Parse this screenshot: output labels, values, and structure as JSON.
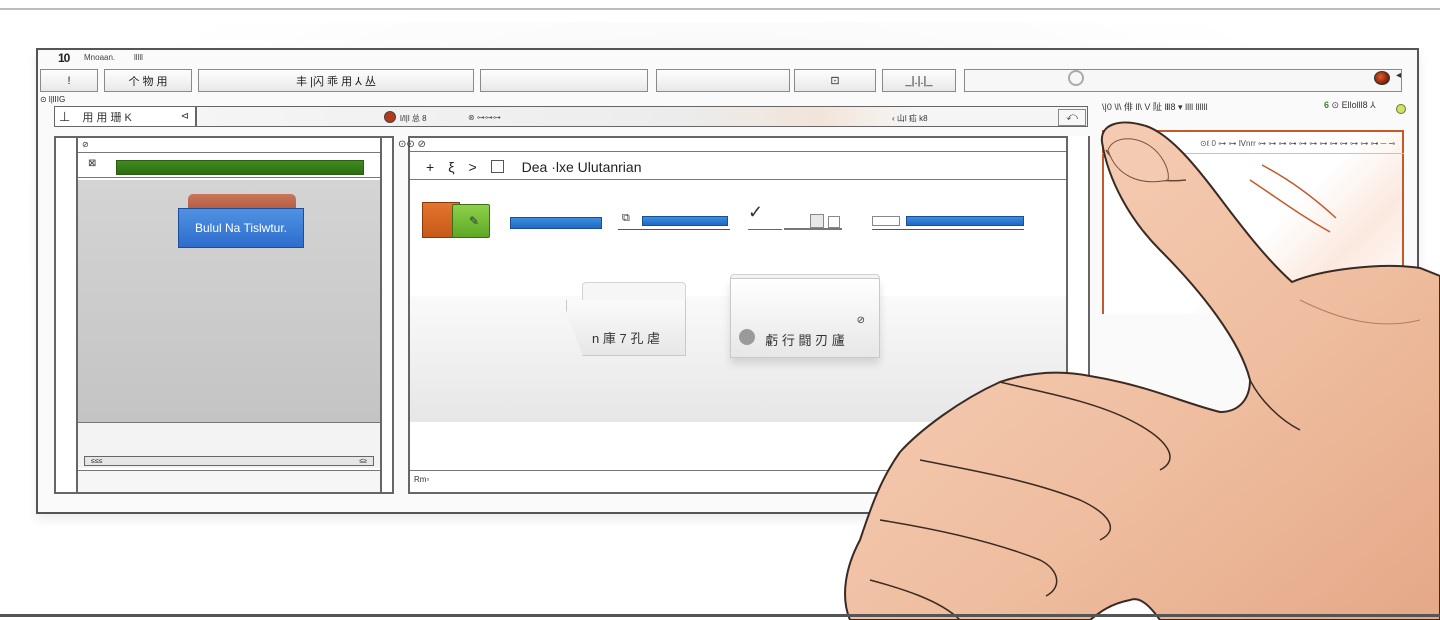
{
  "window": {
    "logo": "10",
    "title": "Mnoaan.",
    "subtitle": "lllll"
  },
  "toolbar": {
    "nav_label": "!",
    "open_label": "个 物 用",
    "tools_label": "丰   |闪 乖 用 ⅄   丛",
    "btn_a_label": "",
    "btn_b_label": "",
    "view_label": "⊡",
    "zoom_label": "_|.|.|_",
    "search_placeholder": ""
  },
  "address": {
    "status": "⊙ l|lIIG",
    "combo_label": "用  用 珊 K",
    "tab1_label": "l/l|l 总 8",
    "tab2_label": "⊗ ⊶⊶⊶",
    "tab3_label": "‹ 山l 疝 k8"
  },
  "left_panel": {
    "header": "⊘",
    "row_icon": "⊠",
    "progress": 1.0,
    "card_label": "Bulul Na Tislwtur.",
    "scroll_left": "≤≤≤",
    "scroll_right": "≤≥"
  },
  "main_panel": {
    "header": "⊙⊙ ⊘",
    "crumb_plus": "+",
    "crumb_sep": "ξ",
    "crumb_arrow": ">",
    "crumb_label": "Dea ·lxe Ulutanrian",
    "card1_label": "n 庫 7 孔 虐",
    "card2_label": "虧 行 闘 刃 廬",
    "status": "Rm▫"
  },
  "right_panel": {
    "tabs_left": "\\|0 \\l\\  俳 ll\\    V 阯 Ⅲ8   ▾  llll llllll",
    "tab_green": "6",
    "tabs_right": "⊙ Ellolll8   ⅄",
    "head_text": "⊙ℓ 0 ⊶ ⊶ Ⅳnrr ⊶ ⊶ ⊶ ⊶ ⊶ ⊶ ⊶ ⊶ ⊶ ⊶ ⊶ ⊶ ─ ⊸"
  },
  "colors": {
    "progress_green": "#2d6d12",
    "card_blue": "#2e6dcc",
    "accent_orange": "#c45a2a",
    "folder_orange": "#e4742e",
    "folder_green": "#6bb12e",
    "skin": "#f0c2a6"
  }
}
